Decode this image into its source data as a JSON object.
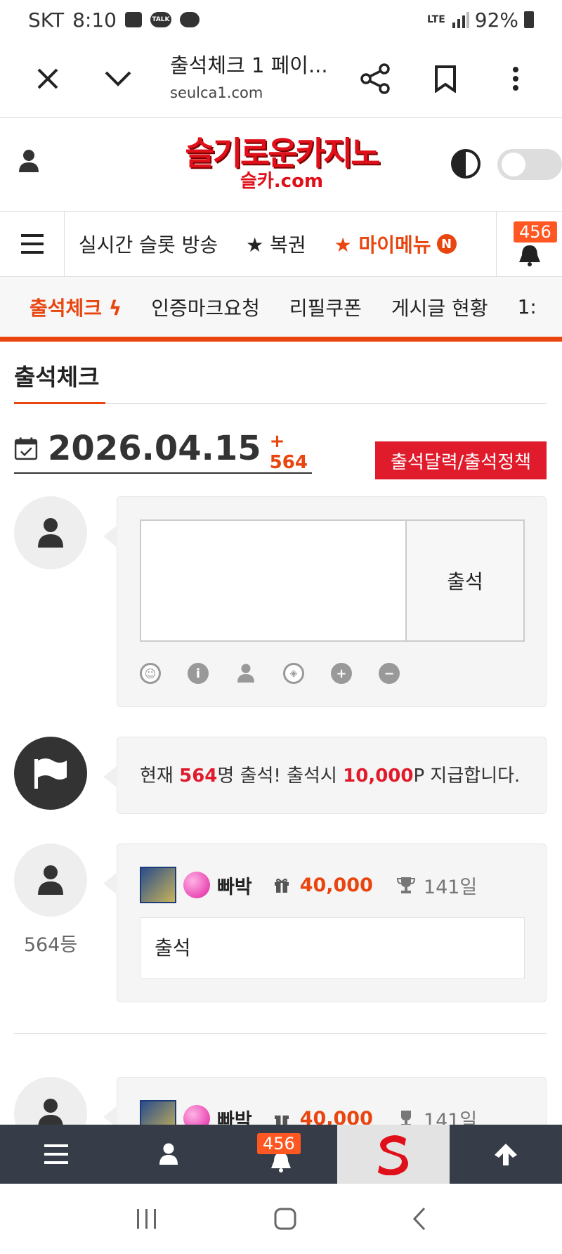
{
  "status_bar": {
    "carrier": "SKT",
    "time": "8:10",
    "talk": "TALK",
    "network": "LTE",
    "battery": "92%"
  },
  "browser": {
    "title": "출석체크 1 페이...",
    "url": "seulca1.com"
  },
  "site": {
    "logo_main": "슬기로운카지노",
    "logo_sub": "슬카.com"
  },
  "main_nav": {
    "items": [
      "실시간 슬롯 방송",
      "★ 복권"
    ],
    "my_menu": "★ 마이메뉴",
    "new_badge": "N",
    "bell_count": "456"
  },
  "sub_nav": {
    "items": [
      {
        "label": "출석체크 ϟ",
        "active": true
      },
      {
        "label": "인증마크요청",
        "active": false
      },
      {
        "label": "리필쿠폰",
        "active": false
      },
      {
        "label": "게시글 현황",
        "active": false
      },
      {
        "label": "1:",
        "active": false
      }
    ]
  },
  "page": {
    "title": "출석체크",
    "date": "2026.04.15",
    "plus_count": "+ 564",
    "calendar_button": "출석달력/출석정책"
  },
  "attend_form": {
    "submit_label": "출석"
  },
  "notice": {
    "prefix": "현재 ",
    "count": "564",
    "mid": "명 출석! 출석시 ",
    "points": "10,000",
    "suffix": "P 지급합니다."
  },
  "entries": [
    {
      "username": "빠박",
      "points": "40,000",
      "days": "141일",
      "text": "출석",
      "rank": "564등"
    },
    {
      "username": "빠박",
      "points": "40,000",
      "days": "141일"
    }
  ],
  "bottom_bar": {
    "bell_count": "456"
  },
  "colors": {
    "accent": "#e8450f",
    "red": "#e01b2b",
    "bottom_bar": "#373d48"
  }
}
